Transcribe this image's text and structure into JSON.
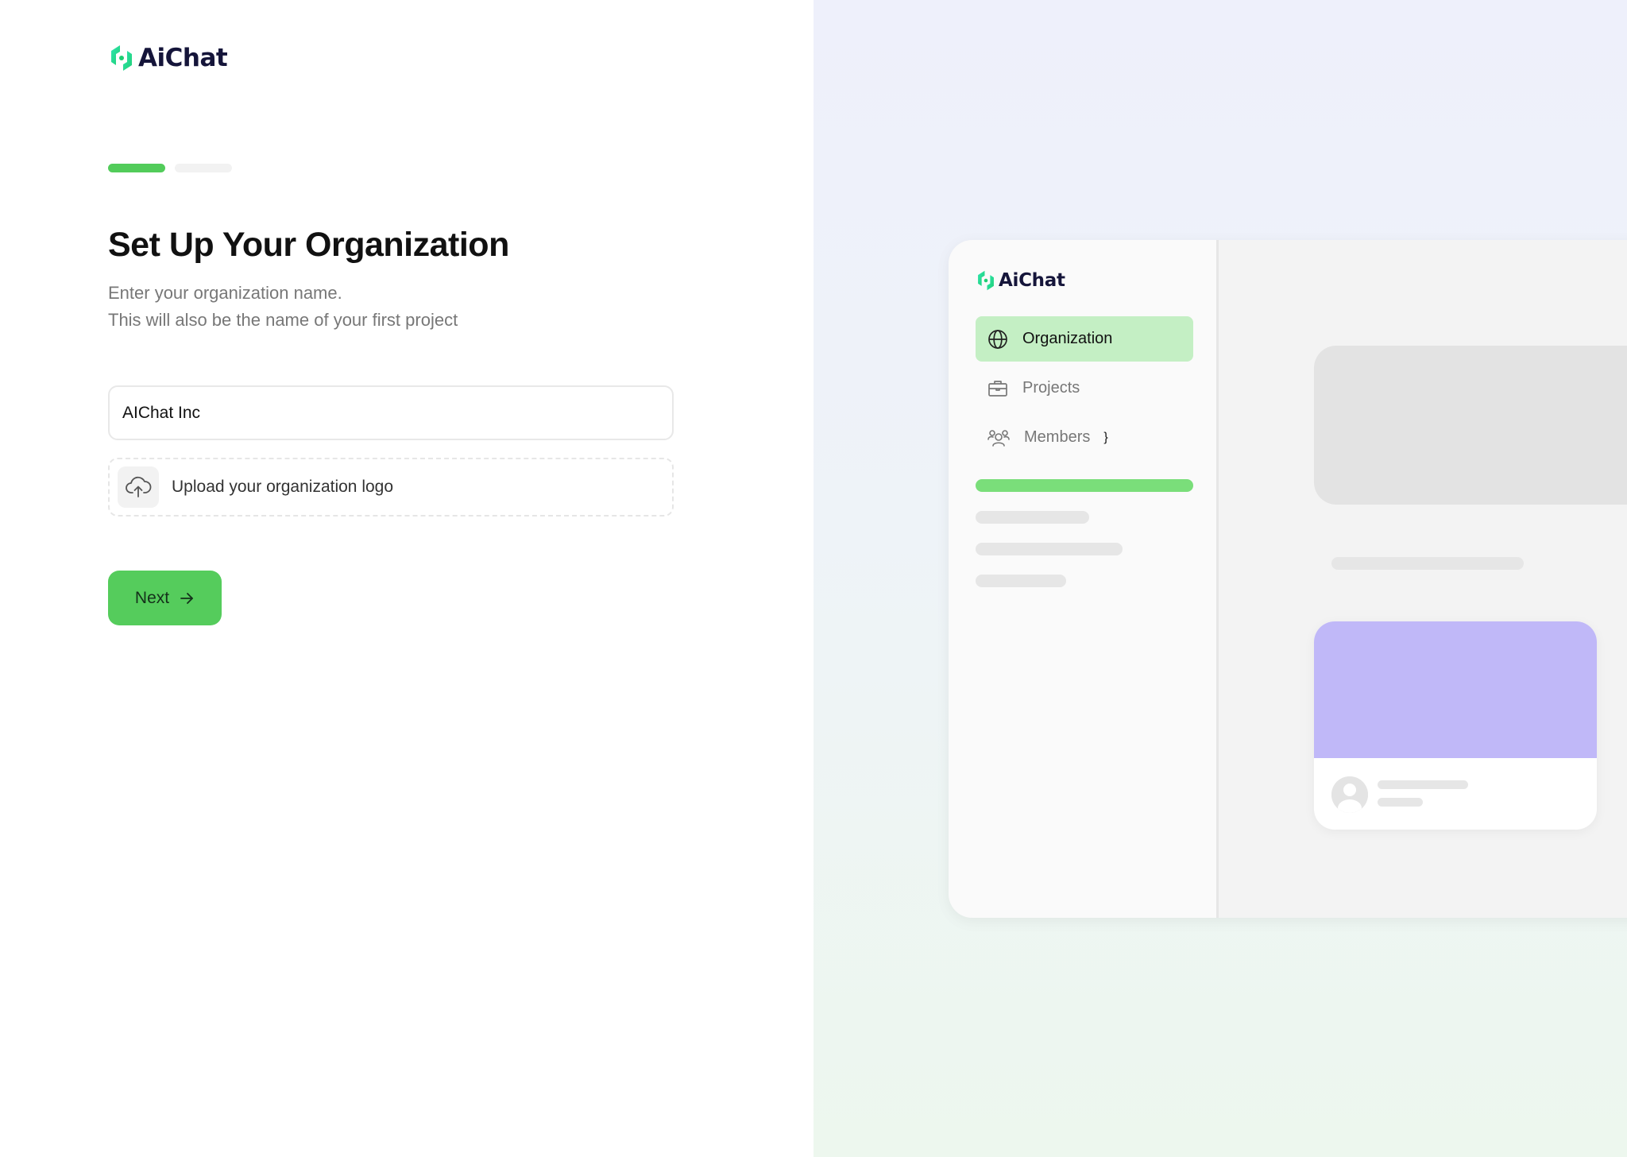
{
  "app": {
    "brand": "AiChat",
    "brand_colors": {
      "mark_light": "#2fe6b0",
      "mark_dark": "#1fce74",
      "text": "#15153a"
    }
  },
  "onboarding": {
    "progress": {
      "current_step": 1,
      "total_steps": 2,
      "active_color": "#52cc5a"
    },
    "title": "Set Up Your Organization",
    "subtitle_line1": "Enter your organization name.",
    "subtitle_line2": "This will also be the name of your first project",
    "org_name_input": {
      "value": "AIChat Inc"
    },
    "upload": {
      "label": "Upload your organization logo",
      "icon": "cloud-upload-icon"
    },
    "next_button": {
      "label": "Next",
      "icon": "arrow-right-icon",
      "color": "#55cc5c"
    }
  },
  "preview": {
    "brand": "AiChat",
    "nav_items": [
      {
        "label": "Organization",
        "icon": "globe-icon",
        "active": true
      },
      {
        "label": "Projects",
        "icon": "briefcase-icon",
        "active": false
      },
      {
        "label": "Members",
        "icon": "users-icon",
        "active": false
      }
    ],
    "colors": {
      "active_nav_bg": "#c4efc4",
      "card_cover": "#c0b8f8",
      "accent_bar": "#7ade7a"
    }
  }
}
